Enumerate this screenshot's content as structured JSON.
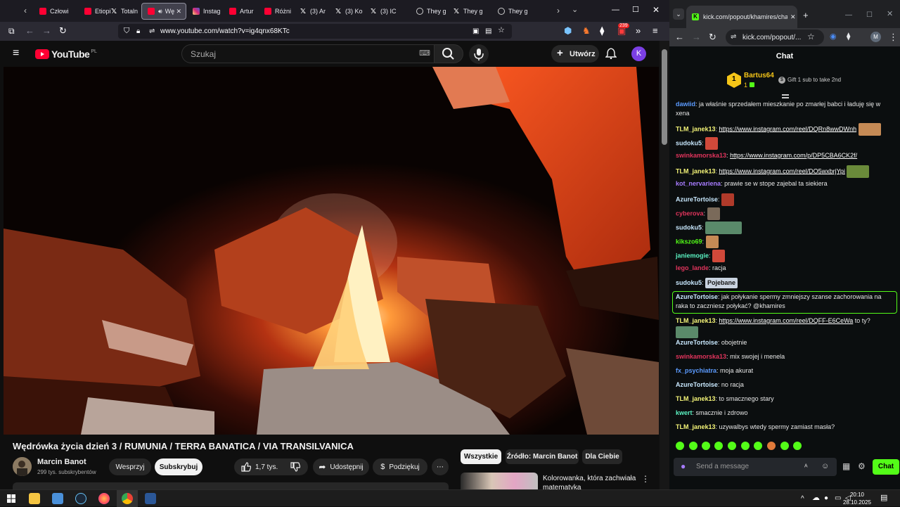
{
  "firefox": {
    "tabs": [
      {
        "label": "Człowi",
        "icon": "youtube-icon",
        "color": "#ff0033"
      },
      {
        "label": "Etiopi",
        "icon": "youtube-icon",
        "color": "#ff0033"
      },
      {
        "label": "Totaln",
        "icon": "x-icon",
        "color": "#ffffff"
      },
      {
        "label": "Wę",
        "icon": "youtube-icon",
        "color": "#ff0033",
        "active": true,
        "audio": true
      },
      {
        "label": "Instag",
        "icon": "instagram-icon",
        "color": "#e1306c"
      },
      {
        "label": "Artur",
        "icon": "youtube-icon",
        "color": "#ff0033"
      },
      {
        "label": "Różni",
        "icon": "youtube-icon",
        "color": "#ff0033"
      },
      {
        "label": "(3) Ar",
        "icon": "x-icon",
        "color": "#ffffff"
      },
      {
        "label": "(3) Ko",
        "icon": "x-icon",
        "color": "#ffffff"
      },
      {
        "label": "(3) IC",
        "icon": "x-icon",
        "color": "#ffffff"
      },
      {
        "label": "They g",
        "icon": "globe-icon",
        "color": "#cccccc"
      },
      {
        "label": "They g",
        "icon": "x-icon",
        "color": "#ffffff"
      },
      {
        "label": "They g",
        "icon": "globe-icon",
        "color": "#cccccc"
      }
    ],
    "url": "www.youtube.com/watch?v=ig4qnx68KTc",
    "notification_count": "239"
  },
  "youtube": {
    "logo_text": "YouTube",
    "region": "PL",
    "search_placeholder": "Szukaj",
    "create_label": "Utwórz",
    "avatar_letter": "K",
    "video_title": "Wędrówka życia dzień 3 / RUMUNIA / TERRA BANATICA / VIA TRANSILVANICA",
    "channel_name": "Marcin Banot",
    "channel_subs": "299 tys. subskrybentów",
    "support_label": "Wesprzyj",
    "subscribe_label": "Subskrybuj",
    "likes": "1,7 tys.",
    "share_label": "Udostępnij",
    "thanks_label": "Podziękuj",
    "chips": [
      "Wszystkie",
      "Źródło: Marcin Banot",
      "Dla Ciebie"
    ],
    "rec_title": "Kolorowanka, która zachwiała matematyką"
  },
  "chrome": {
    "tab_title": "kick.com/popout/khamires/chat",
    "url": "kick.com/popout/...",
    "profile_letter": "M"
  },
  "kick": {
    "header": "Chat",
    "pinned_user": "Bartus64",
    "pinned_rank": "1",
    "pinned_count": "1",
    "gift_text": "Gift 1 sub to take 2nd",
    "input_placeholder": "Send a message",
    "send_label": "Chat",
    "messages": [
      {
        "user": "dawiid",
        "color": "#5b9bff",
        "text": "ja właśnie sprzedałem mieszkanie po zmarłej babci i ładuję się w xena"
      },
      {
        "user": "TLM_janek13",
        "color": "#f5f578",
        "link": "https://www.instagram.com/reel/DQRn8wwDWnh",
        "emote": "img"
      },
      {
        "user": "sudoku5",
        "color": "#c9e9ff",
        "emote": "img"
      },
      {
        "user": "swinkamorska13",
        "color": "#e0345c",
        "link": "https://www.instagram.com/p/DP5CBA6CK2f/"
      },
      {
        "user": "TLM_janek13",
        "color": "#f5f578",
        "link": "https://www.instagram.com/reel/DO5wxbrjYpi",
        "emote": "img"
      },
      {
        "user": "kot_nervariena",
        "color": "#a77cff",
        "text": "prawie se w stope zajebal ta siekiera"
      },
      {
        "user": "AzureTortoise",
        "color": "#c9e9ff",
        "emote": "img"
      },
      {
        "user": "cyberova",
        "color": "#e0345c",
        "emote": "img"
      },
      {
        "user": "sudoku5",
        "color": "#c9e9ff",
        "emote": "img"
      },
      {
        "user": "kikszo69",
        "color": "#53fc18",
        "emote": "img"
      },
      {
        "user": "janiemogie",
        "color": "#5bf3c3",
        "emote": "img"
      },
      {
        "user": "lego_lande",
        "color": "#e0345c",
        "text": "racja"
      },
      {
        "user": "sudoku5",
        "color": "#c9e9ff",
        "emote_text": "Pojebane"
      },
      {
        "user": "AzureTortoise",
        "color": "#c9e9ff",
        "text": "jak połykanie spermy zmniejszy szanse zachorowania na raka to zaczniesz połykać? @khamires",
        "highlight": true
      },
      {
        "user": "TLM_janek13",
        "color": "#f5f578",
        "link": "https://www.instagram.com/reel/DQFF-E6CeWa",
        "text": "to ty?"
      },
      {
        "user": "AzureTortoise",
        "color": "#c9e9ff",
        "text": "obojetnie"
      },
      {
        "user": "swinkamorska13",
        "color": "#e0345c",
        "text": "mix swojej i menela"
      },
      {
        "user": "fx_psychiatra",
        "color": "#5b9bff",
        "text": "moja akurat"
      },
      {
        "user": "AzureTortoise",
        "color": "#c9e9ff",
        "text": "no racja"
      },
      {
        "user": "TLM_janek13",
        "color": "#f5f578",
        "text": "to smacznego stary"
      },
      {
        "user": "kwert",
        "color": "#5bf3c3",
        "text": "smacznie i zdrowo"
      },
      {
        "user": "TLM_janek13",
        "color": "#f5f578",
        "text": "uzywalbys wtedy spermy zamiast masła?"
      }
    ]
  },
  "taskbar": {
    "time": "20:10",
    "date": "28.10.2025"
  }
}
